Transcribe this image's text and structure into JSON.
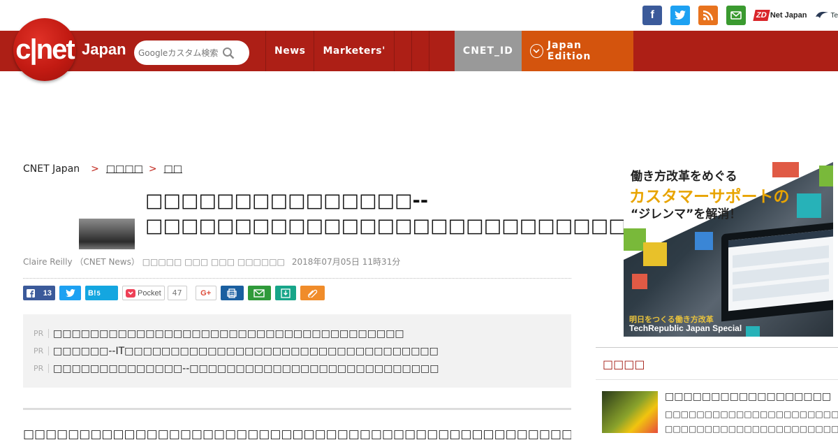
{
  "social": {
    "icons": [
      "facebook-icon",
      "twitter-icon",
      "rss-icon",
      "mail-icon"
    ],
    "zdnet_prefix": "ZD",
    "zdnet_label": "Net Japan",
    "techrepublic_label": "Te"
  },
  "header": {
    "logo_text": "c|net",
    "edition": "Japan",
    "search_placeholder": "Googleカスタム検索",
    "nav": [
      {
        "label": "News"
      },
      {
        "label": "Marketers'"
      }
    ],
    "cnet_id": "CNET_ID",
    "japan_edition": "Japan Edition"
  },
  "breadcrumb": {
    "root": "CNET Japan",
    "level1": "□□□□",
    "level2": "□□"
  },
  "article": {
    "title": "□□□□□□□□□□□□□□□--□□□□□□□□□□□□□□□□□□□□□□□□□□□□□□",
    "author": "Claire Reilly （CNET News） □□□□□ □□□ □□□ □□□□□□",
    "date": "2018年07月05日 11時31分",
    "share": {
      "facebook_count": "13",
      "hatena_label": "B!",
      "hatena_count": "5",
      "pocket_label": "Pocket",
      "pocket_count": "47",
      "gplus_label": "G+"
    },
    "pr_tag": "PR",
    "pr_items": [
      "□□□□□□□□□□□□□□□□□□□□□□□□□□□□□□□□□□□□□□",
      "□□□□□□--IT□□□□□□□□□□□□□□□□□□□□□□□□□□□□□□□□□□",
      "□□□□□□□□□□□□□□--□□□□□□□□□□□□□□□□□□□□□□□□□□□"
    ],
    "body_first_line": "□□□□□□□□□□□□□□□□□□□□□□□□□□□□□□□□□□□□□□□□□□□□□□□□□□□□"
  },
  "sidebar": {
    "ad": {
      "line1": "働き方改革をめぐる",
      "line2": "カスタマーサポートの",
      "line3": "“ジレンマ”を解消！",
      "footer1": "明日をつくる働き方改革",
      "footer2": "TechRepublic Japan Special"
    },
    "section_title": "□□□□",
    "feature": {
      "title": "□□□□□□□□□□□□□□□□□□",
      "subtitle_lines": [
        "□□□□□□□□□□□□□□□□□□□□□□□",
        "□□□□□□□□□□□□□□□□□□□□□□"
      ]
    }
  },
  "colors": {
    "brand_red": "#ad1f16",
    "cnet_id_gray": "#999999",
    "japan_edition_orange": "#d4540d",
    "pr_box_bg": "#f2f2f2"
  }
}
